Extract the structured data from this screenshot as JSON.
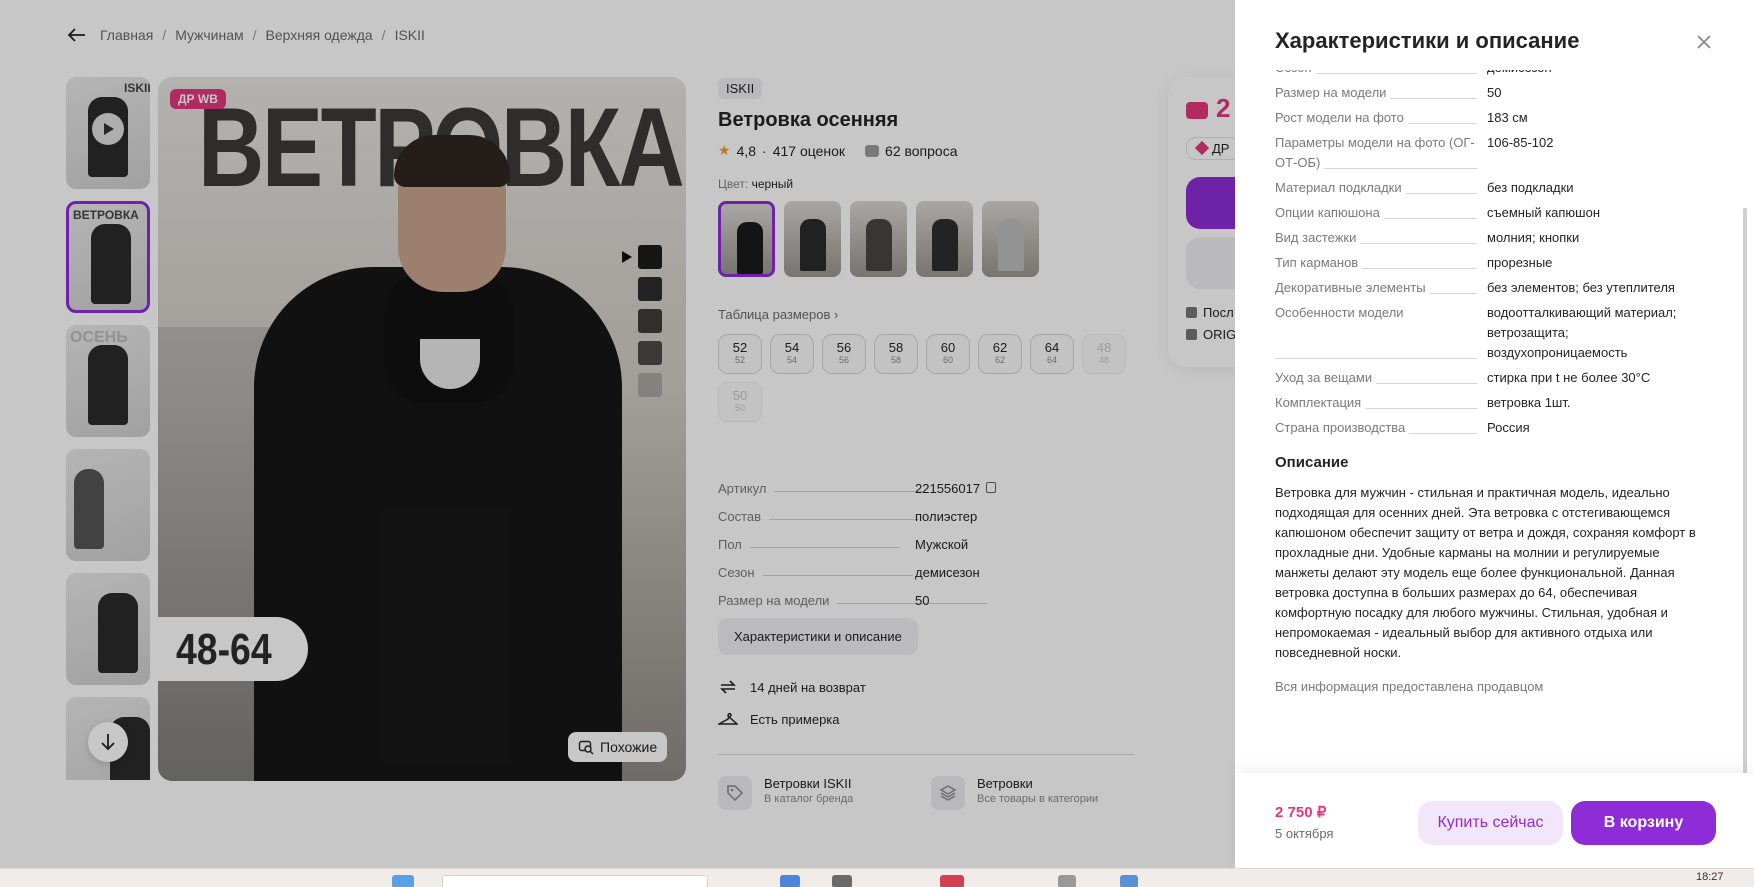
{
  "breadcrumb": [
    "Главная",
    "Мужчинам",
    "Верхняя одежда",
    "ISKII"
  ],
  "gallery": {
    "thumb_texts": [
      "ISKII",
      "ВЕТРОВКА",
      "ОСЕНЬ",
      "",
      "",
      ""
    ],
    "photo_badge": "ДР WB",
    "photo_word": "ВЕТРОВКА",
    "photo_size_range": "48-64",
    "similar_label": "Похожие"
  },
  "product": {
    "brand": "ISKII",
    "title": "Ветровка осенняя",
    "rating": "4,8",
    "reviews": "417 оценок",
    "questions": "62 вопроса",
    "color_label": "Цвет:",
    "color_value": "черный",
    "size_table_link": "Таблица размеров",
    "sizes": [
      {
        "main": "52",
        "sub": "52",
        "available": true
      },
      {
        "main": "54",
        "sub": "54",
        "available": true
      },
      {
        "main": "56",
        "sub": "56",
        "available": true
      },
      {
        "main": "58",
        "sub": "58",
        "available": true
      },
      {
        "main": "60",
        "sub": "60",
        "available": true
      },
      {
        "main": "62",
        "sub": "62",
        "available": true
      },
      {
        "main": "64",
        "sub": "64",
        "available": true
      },
      {
        "main": "48",
        "sub": "48",
        "available": false
      },
      {
        "main": "50",
        "sub": "50",
        "available": false
      }
    ],
    "specs": [
      {
        "k": "Артикул",
        "v": "221556017"
      },
      {
        "k": "Состав",
        "v": "полиэстер"
      },
      {
        "k": "Пол",
        "v": "Мужской"
      },
      {
        "k": "Сезон",
        "v": "демисезон"
      },
      {
        "k": "Размер на модели",
        "v": "50"
      }
    ],
    "char_button": "Характеристики и описание",
    "features": [
      "14 дней на возврат",
      "Есть примерка"
    ],
    "brand_card": {
      "title": "Ветровки ISKII",
      "sub": "В каталог бренда"
    },
    "category_card": {
      "title": "Ветровки",
      "sub": "Все товары в категории"
    }
  },
  "price_card": {
    "price": "2",
    "dr": "ДР",
    "line1": "Посл",
    "line2": "ORIG"
  },
  "panel": {
    "title": "Характеристики и описание",
    "specs": [
      {
        "k": "Сезон",
        "v": "демисезон"
      },
      {
        "k": "Размер на модели",
        "v": "50"
      },
      {
        "k": "Рост модели на фото",
        "v": "183 см"
      },
      {
        "k": "Параметры модели на фото (ОГ-ОТ-ОБ)",
        "v": "106-85-102"
      },
      {
        "k": "Материал подкладки",
        "v": "без подкладки"
      },
      {
        "k": "Опции капюшона",
        "v": "съемный капюшон"
      },
      {
        "k": "Вид застежки",
        "v": "молния; кнопки"
      },
      {
        "k": "Тип карманов",
        "v": "прорезные"
      },
      {
        "k": "Декоративные элементы",
        "v": "без элементов; без утеплителя"
      },
      {
        "k": "Особенности модели",
        "v": "водоотталкивающий материал; ветрозащита; воздухопроницаемость"
      },
      {
        "k": "Уход за вещами",
        "v": "стирка при t не более 30°C"
      },
      {
        "k": "Комплектация",
        "v": "ветровка 1шт."
      },
      {
        "k": "Страна производства",
        "v": "Россия"
      }
    ],
    "desc_title": "Описание",
    "desc_text": "Ветровка для мужчин - стильная и практичная модель, идеально подходящая для осенних дней. Эта ветровка с отстегивающемся капюшоном обеспечит защиту от ветра и дождя, сохраняя комфорт в прохладные дни. Удобные карманы на молнии и регулируемые манжеты делают эту модель еще более функциональной. Данная ветровка доступна в больших размерах до 64, обеспечивая комфортную посадку для любого мужчины. Стильная, удобная и непромокаемая - идеальный выбор для активного отдыха или повседневной носки.",
    "desc_note": "Вся информация предоставлена продавцом",
    "footer_price": "2 750 ₽",
    "footer_date": "5 октября",
    "buy_now": "Купить сейчас",
    "to_cart": "В корзину"
  },
  "taskbar": {
    "clock": "18:27"
  },
  "colors": {
    "accent": "#8e2cd8",
    "price": "#e4377e",
    "star": "#f29b34"
  }
}
